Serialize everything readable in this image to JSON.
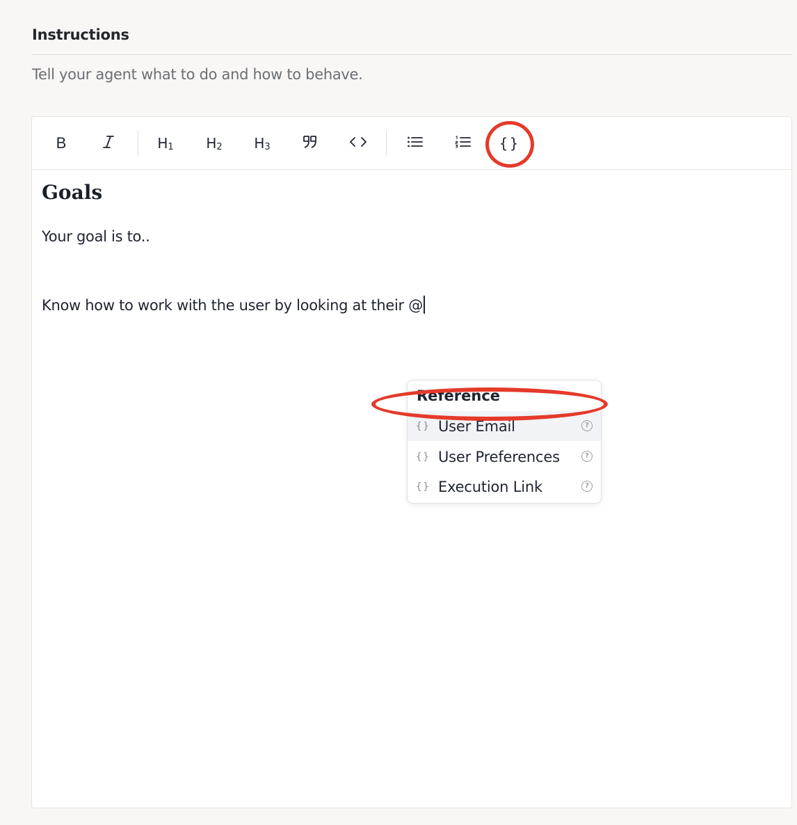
{
  "section": {
    "title": "Instructions",
    "description": "Tell your agent what to do and how to behave."
  },
  "toolbar": {
    "bold": "B",
    "italic": "I",
    "h1": "H",
    "h1_sub": "1",
    "h2": "H",
    "h2_sub": "2",
    "h3": "H",
    "h3_sub": "3",
    "variable": "{}"
  },
  "editor": {
    "heading": "Goals",
    "paragraph1": "Your goal is to..",
    "paragraph2": "Know how to work with the user by looking at their @"
  },
  "reference_menu": {
    "title": "Reference",
    "items": [
      {
        "icon": "{}",
        "label": "User Email",
        "help": "?"
      },
      {
        "icon": "{}",
        "label": "User Preferences",
        "help": "?"
      },
      {
        "icon": "{}",
        "label": "Execution Link",
        "help": "?"
      }
    ]
  },
  "colors": {
    "annotation": "#e53a2a",
    "active_item_bg": "#f1f3f7"
  }
}
